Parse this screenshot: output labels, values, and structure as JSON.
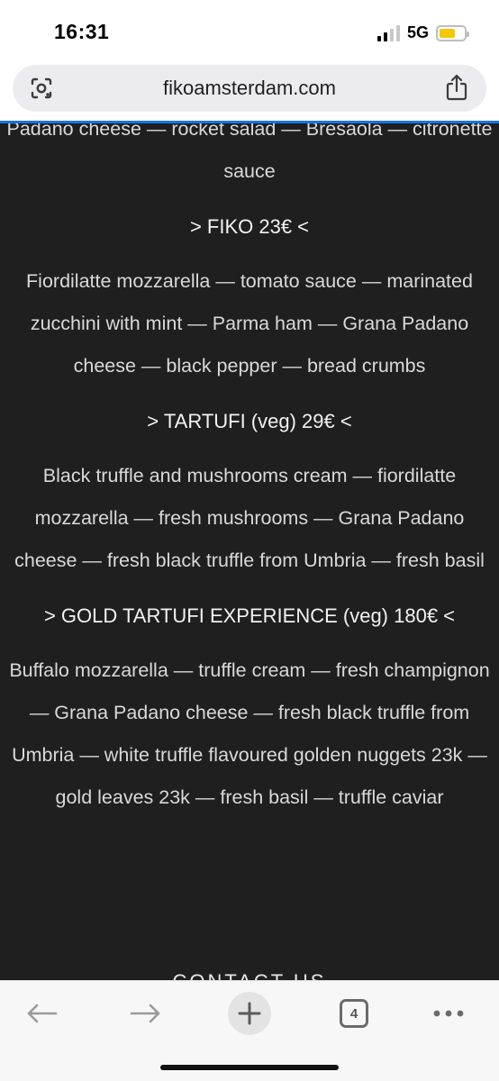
{
  "status": {
    "time": "16:31",
    "network": "5G",
    "signal_bars_active": 2,
    "signal_bars_total": 4,
    "battery_level": 0.65,
    "battery_color": "#f5c800"
  },
  "browser": {
    "url": "fikoamsterdam.com",
    "lens_icon": "google-lens-icon",
    "share_icon": "share-icon",
    "progress_color": "#1a73e8",
    "open_tabs": "4",
    "toolbar_icons": [
      "back-arrow-icon",
      "forward-arrow-icon",
      "new-tab-plus-icon",
      "tab-switcher-icon",
      "more-menu-icon"
    ]
  },
  "menu": {
    "items": [
      {
        "text": "Padano cheese — rocket salad — Bresaola — citronette",
        "kind": "desc"
      },
      {
        "text": "sauce",
        "kind": "desc"
      },
      {
        "text": "> FIKO 23€ <",
        "kind": "heading"
      },
      {
        "text": "Fiordilatte mozzarella — tomato sauce — marinated",
        "kind": "desc"
      },
      {
        "text": "zucchini with mint — Parma ham — Grana Padano",
        "kind": "desc"
      },
      {
        "text": "cheese — black pepper — bread crumbs",
        "kind": "desc"
      },
      {
        "text": "> TARTUFI (veg) 29€ <",
        "kind": "heading"
      },
      {
        "text": "Black truffle and mushrooms cream — fiordilatte",
        "kind": "desc"
      },
      {
        "text": "mozzarella — fresh mushrooms — Grana Padano",
        "kind": "desc"
      },
      {
        "text": "cheese — fresh black truffle from Umbria — fresh basil",
        "kind": "desc"
      },
      {
        "text": "> GOLD TARTUFI EXPERIENCE  (veg) 180€ <",
        "kind": "heading"
      },
      {
        "text": "Buffalo mozzarella — truffle cream — fresh champignon",
        "kind": "desc"
      },
      {
        "text": "— Grana Padano cheese — fresh black truffle from",
        "kind": "desc"
      },
      {
        "text": "Umbria — white truffle flavoured golden nuggets 23k —",
        "kind": "desc"
      },
      {
        "text": "gold leaves 23k — fresh basil — truffle caviar",
        "kind": "desc"
      }
    ],
    "footer_cut_text": "CONTACT US"
  }
}
